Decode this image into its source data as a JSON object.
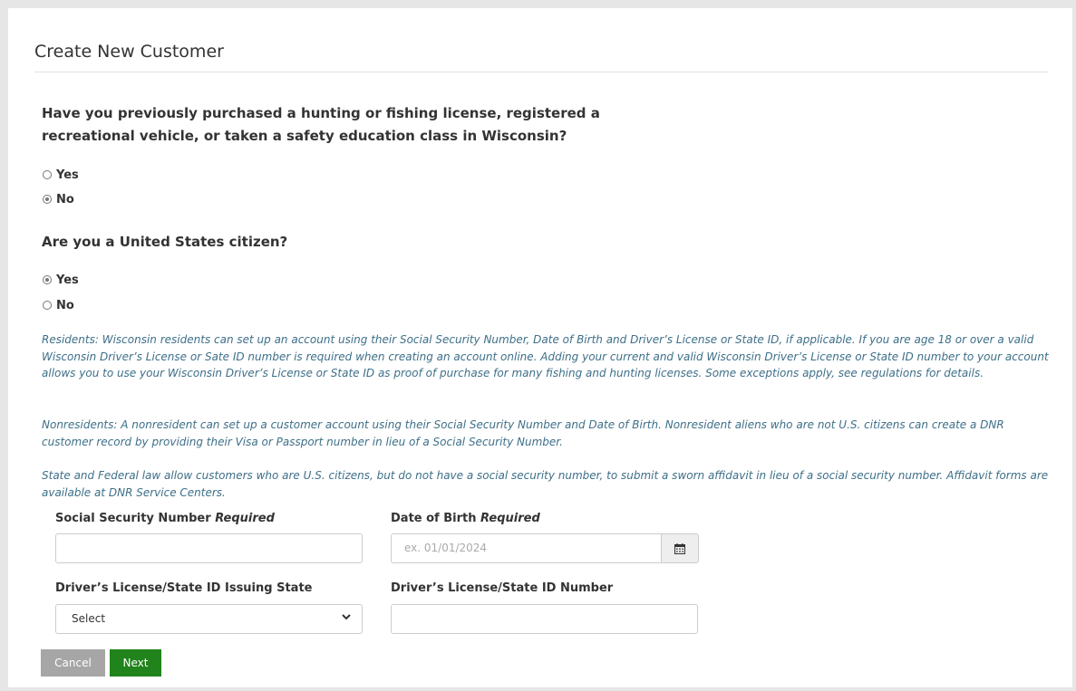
{
  "page": {
    "title": "Create New Customer"
  },
  "question_prior_purchase": {
    "text": "Have you previously purchased a hunting or fishing license, registered a recreational vehicle, or taken a safety education class in Wisconsin?",
    "options": [
      {
        "label": "Yes",
        "checked": false
      },
      {
        "label": "No",
        "checked": true
      }
    ]
  },
  "question_citizen": {
    "text": "Are you a United States citizen?",
    "options": [
      {
        "label": "Yes",
        "checked": true
      },
      {
        "label": "No",
        "checked": false
      }
    ]
  },
  "info": {
    "residents": "Residents: Wisconsin residents can set up an account using their Social Security Number, Date of Birth and Driver’s License or State ID, if applicable. If you are age 18 or over a valid Wisconsin Driver’s License or Sate ID number is required when creating an account online. Adding your current and valid Wisconsin Driver’s License or State ID number to your account allows you to use your Wisconsin Driver’s License or State ID as proof of purchase for many fishing and hunting licenses. Some exceptions apply, see regulations for details.",
    "nonresidents": "Nonresidents: A nonresident can set up a customer account using their Social Security Number and Date of Birth. Nonresident aliens who are not U.S. citizens can create a DNR customer record by providing their Visa or Passport number in lieu of a Social Security Number.",
    "affidavit": "State and Federal law allow customers who are U.S. citizens, but do not have a social security number, to submit a sworn affidavit in lieu of a social security number. Affidavit forms are available at DNR Service Centers."
  },
  "form": {
    "ssn": {
      "label": "Social Security Number",
      "required_label": "Required",
      "value": ""
    },
    "dob": {
      "label": "Date of Birth",
      "required_label": "Required",
      "placeholder": "ex. 01/01/2024",
      "value": "",
      "icon": "calendar-icon"
    },
    "dl_state": {
      "label": "Driver’s License/State ID Issuing State",
      "selected": "Select",
      "icon": "chevron-down-icon"
    },
    "dl_number": {
      "label": "Driver’s License/State ID Number",
      "value": ""
    }
  },
  "buttons": {
    "cancel": "Cancel",
    "next": "Next"
  },
  "colors": {
    "page_background": "#e6e6e6",
    "info_text": "#3d6f88",
    "cancel_button": "#a6a6a6",
    "next_button": "#21831b"
  }
}
